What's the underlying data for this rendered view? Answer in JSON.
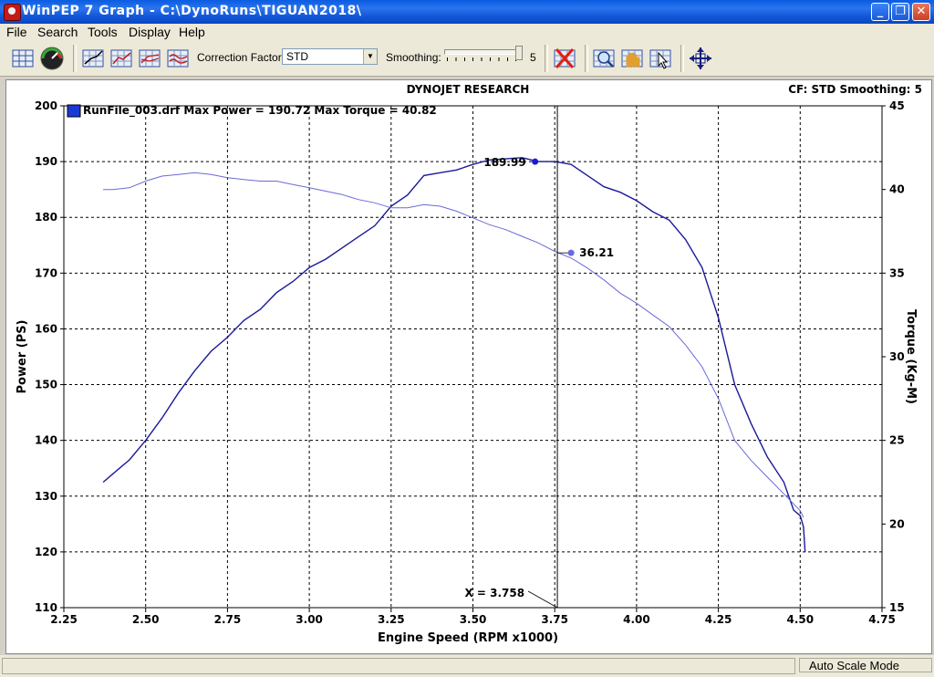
{
  "window": {
    "title": "WinPEP 7    Graph - C:\\DynoRuns\\TIGUAN2018\\",
    "minimize": "_",
    "maximize": "❐",
    "close": "✕"
  },
  "menu": {
    "file": "File",
    "search": "Search",
    "tools": "Tools",
    "display": "Display",
    "help": "Help"
  },
  "toolbar": {
    "correction_label": "Correction Factor:",
    "correction_value": "STD",
    "smoothing_label": "Smoothing:",
    "smoothing_value": "5",
    "icons": [
      "grid-icon",
      "gauge-icon",
      "graph-cursor-icon",
      "graph-line-icon",
      "graph-multi-icon",
      "graph-wave-icon",
      "clear-graph-icon",
      "zoom-icon",
      "pan-hand-icon",
      "select-graph-icon",
      "scale-arrows-icon"
    ]
  },
  "status": {
    "mode": "Auto Scale Mode"
  },
  "chart_data": {
    "type": "line",
    "title": "DYNOJET RESEARCH",
    "header_right": "CF: STD  Smoothing: 5",
    "legend": "RunFile_003.drf Max Power = 190.72 Max Torque = 40.82",
    "xlabel": "Engine Speed (RPM x1000)",
    "ylabel": "Power (PS)",
    "y2label": "Torque (Kg-M)",
    "xlim": [
      2.25,
      4.75
    ],
    "ylim": [
      110,
      200
    ],
    "y2lim": [
      15,
      45
    ],
    "x_ticks": [
      "2.25",
      "2.50",
      "2.75",
      "3.00",
      "3.25",
      "3.50",
      "3.75",
      "4.00",
      "4.25",
      "4.50",
      "4.75"
    ],
    "y_ticks": [
      "110",
      "120",
      "130",
      "140",
      "150",
      "160",
      "170",
      "180",
      "190",
      "200"
    ],
    "y2_ticks": [
      "15",
      "20",
      "25",
      "30",
      "35",
      "40",
      "45"
    ],
    "grid": true,
    "cursor_x": 3.758,
    "cursor_label": "X = 3.758",
    "power_marker": {
      "x": 3.69,
      "value": 189.99,
      "label": "189.99"
    },
    "torque_marker": {
      "x": 3.8,
      "value": 36.21,
      "label": "36.21"
    },
    "series": [
      {
        "name": "Power",
        "axis": "left",
        "color": "#1a1a9a",
        "x": [
          2.37,
          2.4,
          2.45,
          2.5,
          2.55,
          2.6,
          2.65,
          2.7,
          2.75,
          2.8,
          2.85,
          2.9,
          2.95,
          3.0,
          3.05,
          3.1,
          3.15,
          3.2,
          3.25,
          3.3,
          3.35,
          3.4,
          3.45,
          3.5,
          3.55,
          3.6,
          3.65,
          3.7,
          3.75,
          3.8,
          3.85,
          3.9,
          3.95,
          4.0,
          4.05,
          4.1,
          4.15,
          4.2,
          4.25,
          4.3,
          4.35,
          4.4,
          4.45,
          4.48,
          4.5,
          4.51,
          4.515
        ],
        "values": [
          132.5,
          134.0,
          136.5,
          140.0,
          144.0,
          148.5,
          152.5,
          156.0,
          158.5,
          161.5,
          163.5,
          166.5,
          168.5,
          171.0,
          172.5,
          174.5,
          176.5,
          178.5,
          182.0,
          184.0,
          187.5,
          188.0,
          188.5,
          189.5,
          190.3,
          190.5,
          190.7,
          190.0,
          190.0,
          189.5,
          187.5,
          185.5,
          184.5,
          183.0,
          181.0,
          179.5,
          176.0,
          171.0,
          162.0,
          150.0,
          143.0,
          137.0,
          132.5,
          127.5,
          126.5,
          124.5,
          120.0
        ]
      },
      {
        "name": "Torque",
        "axis": "right",
        "color": "#6a6ad8",
        "x": [
          2.37,
          2.4,
          2.45,
          2.5,
          2.55,
          2.6,
          2.65,
          2.7,
          2.75,
          2.8,
          2.85,
          2.9,
          2.95,
          3.0,
          3.05,
          3.1,
          3.15,
          3.2,
          3.25,
          3.3,
          3.35,
          3.4,
          3.45,
          3.5,
          3.55,
          3.6,
          3.65,
          3.7,
          3.75,
          3.8,
          3.85,
          3.9,
          3.95,
          4.0,
          4.05,
          4.1,
          4.15,
          4.2,
          4.25,
          4.3,
          4.35,
          4.4,
          4.45,
          4.48,
          4.5,
          4.51
        ],
        "values": [
          40.0,
          40.0,
          40.1,
          40.5,
          40.8,
          40.9,
          41.0,
          40.9,
          40.7,
          40.6,
          40.5,
          40.5,
          40.3,
          40.1,
          39.9,
          39.7,
          39.4,
          39.2,
          38.9,
          38.9,
          39.1,
          39.0,
          38.7,
          38.3,
          37.9,
          37.6,
          37.2,
          36.8,
          36.3,
          35.9,
          35.3,
          34.6,
          33.8,
          33.2,
          32.5,
          31.8,
          30.7,
          29.4,
          27.5,
          25.0,
          23.8,
          22.8,
          21.8,
          21.2,
          20.8,
          20.4
        ]
      }
    ]
  }
}
